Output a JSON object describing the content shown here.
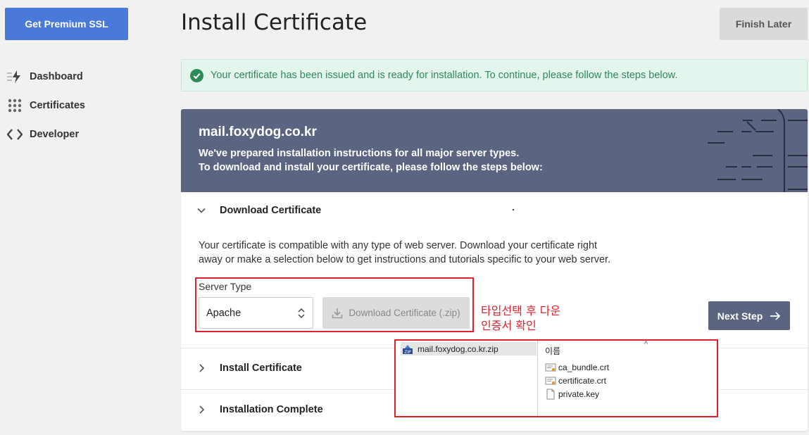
{
  "sidebar": {
    "premium_button": "Get Premium SSL",
    "items": [
      {
        "label": "Dashboard",
        "icon": "lightning-icon"
      },
      {
        "label": "Certificates",
        "icon": "grid-icon"
      },
      {
        "label": "Developer",
        "icon": "code-icon"
      }
    ]
  },
  "header": {
    "title": "Install Certificate",
    "finish_later": "Finish Later"
  },
  "alert": {
    "message": "Your certificate has been issued and is ready for installation. To continue, please follow the steps below.",
    "color": "#2e8b57"
  },
  "card": {
    "domain": "mail.foxydog.co.kr",
    "line1": "We've prepared installation instructions for all major server types.",
    "line2": "To download and install your certificate, please follow the steps below:",
    "header_color": "#5b6582"
  },
  "steps": {
    "download": {
      "title": "Download Certificate",
      "description_1": "Your certificate is compatible with any type of web server. Download your certificate right",
      "description_2": "away or make a selection below to get instructions and tutorials specific to your web server.",
      "server_type_label": "Server Type",
      "server_type_value": "Apache",
      "download_button": "Download Certificate (.zip)",
      "next_button": "Next Step"
    },
    "install": {
      "title": "Install Certificate"
    },
    "complete": {
      "title": "Installation Complete"
    }
  },
  "annotation": {
    "line1": "타입선택 후 다운",
    "line2": "인증서 확인",
    "color": "#e0202a"
  },
  "explorer": {
    "zip_name": "mail.foxydog.co.kr.zip",
    "column_header": "이름",
    "files": [
      {
        "name": "ca_bundle.crt",
        "icon": "certificate-file-icon"
      },
      {
        "name": "certificate.crt",
        "icon": "certificate-file-icon"
      },
      {
        "name": "private.key",
        "icon": "blank-file-icon"
      }
    ]
  }
}
